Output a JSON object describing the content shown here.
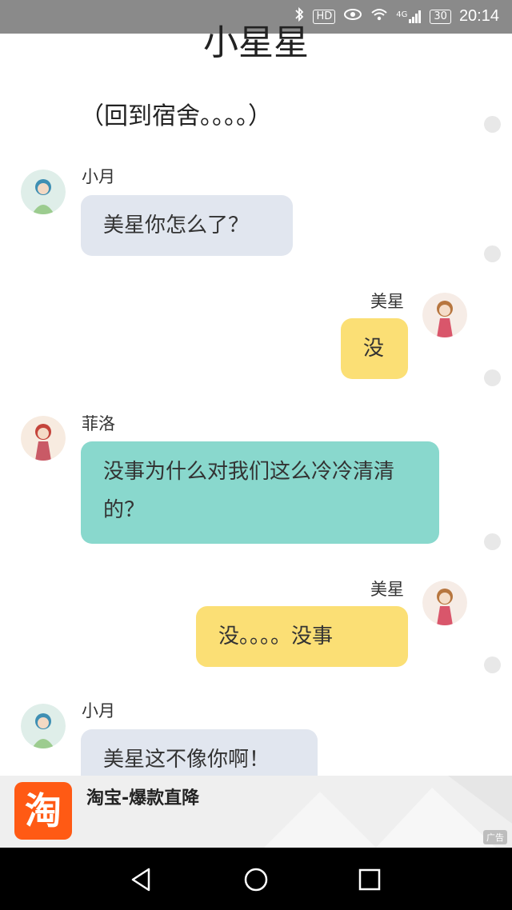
{
  "status_bar": {
    "hd": "HD",
    "network": "4G",
    "battery": "30",
    "time": "20:14"
  },
  "header": {
    "title": "小星星"
  },
  "chat": {
    "narration": "（回到宿舍。。。。）",
    "messages": [
      {
        "sender": "小月",
        "text": "美星你怎么了？",
        "side": "left",
        "bubble_color": "#e1e6ef"
      },
      {
        "sender": "美星",
        "text": "没",
        "side": "right",
        "bubble_color": "#fbdf75"
      },
      {
        "sender": "菲洛",
        "text": "没事为什么对我们这么冷冷清清的？",
        "side": "left",
        "bubble_color": "#89d8cd"
      },
      {
        "sender": "美星",
        "text": "没。。。。没事",
        "side": "right",
        "bubble_color": "#fbdf75"
      },
      {
        "sender": "小月",
        "text": "美星这不像你啊！",
        "side": "left",
        "bubble_color": "#e1e6ef"
      }
    ]
  },
  "ad": {
    "logo_char": "淘",
    "text": "淘宝-爆款直降",
    "tag": "广告"
  }
}
